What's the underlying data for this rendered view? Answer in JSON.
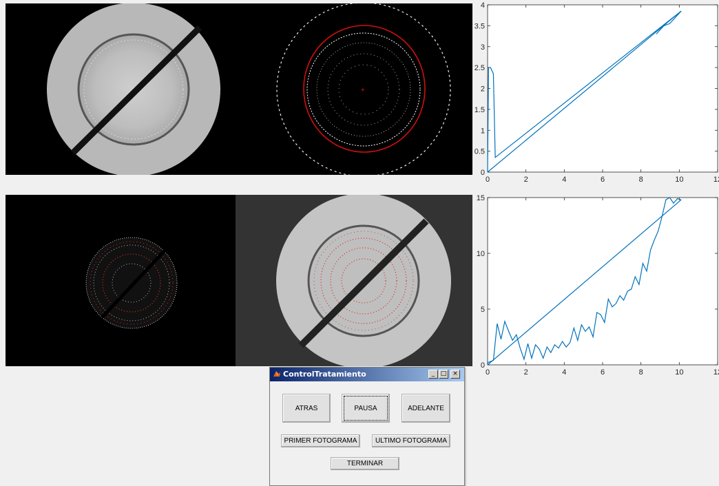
{
  "window": {
    "title": "ControlTratamiento",
    "minimize_glyph": "_",
    "maximize_glyph": "□",
    "close_glyph": "×",
    "icon": "matlab-icon"
  },
  "buttons": {
    "atras": "ATRAS",
    "pausa": "PAUSA",
    "adelante": "ADELANTE",
    "primer": "PRIMER FOTOGRAMA",
    "ultimo": "ULTIMO FOTOGRAMA",
    "terminar": "TERMINAR"
  },
  "colors": {
    "line": "#0072bd",
    "red_marks": "#ff2020"
  },
  "chart_data": [
    {
      "type": "line",
      "xlim": [
        0,
        12
      ],
      "ylim": [
        0,
        4
      ],
      "xticks": [
        "0",
        "2",
        "4",
        "6",
        "8",
        "10",
        "12"
      ],
      "yticks": [
        "0",
        "0.5",
        "1",
        "1.5",
        "2",
        "2.5",
        "3",
        "3.5",
        "4"
      ],
      "series": [
        {
          "x": [
            0,
            0.05,
            0.15,
            0.3,
            0.4,
            10.1
          ],
          "y": [
            0,
            2.5,
            2.5,
            2.35,
            0.35,
            3.85
          ]
        },
        {
          "x": [
            0,
            10.1
          ],
          "y": [
            0,
            3.85
          ]
        },
        {
          "x": [
            8.8,
            9.2,
            9.5,
            9.8,
            10.1
          ],
          "y": [
            3.3,
            3.5,
            3.55,
            3.7,
            3.85
          ]
        }
      ]
    },
    {
      "type": "line",
      "xlim": [
        0,
        12
      ],
      "ylim": [
        0,
        15
      ],
      "xticks": [
        "0",
        "2",
        "4",
        "6",
        "8",
        "10",
        "12"
      ],
      "yticks": [
        "0",
        "5",
        "10",
        "15"
      ],
      "series": [
        {
          "x": [
            0,
            10.1
          ],
          "y": [
            0,
            14.8
          ]
        },
        {
          "x": [
            0,
            0.3,
            0.5,
            0.7,
            0.9,
            1.1,
            1.3,
            1.5,
            1.7,
            1.9,
            2.1,
            2.3,
            2.5,
            2.7,
            2.9,
            3.1,
            3.3,
            3.5,
            3.7,
            3.9,
            4.1,
            4.3,
            4.5,
            4.7,
            4.9,
            5.1,
            5.3,
            5.5,
            5.7,
            5.9,
            6.1,
            6.3,
            6.5,
            6.7,
            6.9,
            7.1,
            7.3,
            7.5,
            7.7,
            7.9,
            8.1,
            8.3,
            8.5,
            8.7,
            8.9,
            9.1,
            9.3,
            9.5,
            9.7,
            9.9,
            10.1
          ],
          "y": [
            0.2,
            0.4,
            3.7,
            2.3,
            3.9,
            3.0,
            2.2,
            2.7,
            1.5,
            0.5,
            1.9,
            0.6,
            1.8,
            1.4,
            0.6,
            1.6,
            1.1,
            1.8,
            1.5,
            2.1,
            1.6,
            2.0,
            3.3,
            2.2,
            3.6,
            3.0,
            3.4,
            2.5,
            4.7,
            4.5,
            3.8,
            5.9,
            5.2,
            5.5,
            6.2,
            5.8,
            6.6,
            6.8,
            7.9,
            7.2,
            9.1,
            8.4,
            10.3,
            11.2,
            12.0,
            13.3,
            14.8,
            15.0,
            14.5,
            14.9,
            14.8
          ]
        }
      ]
    }
  ]
}
